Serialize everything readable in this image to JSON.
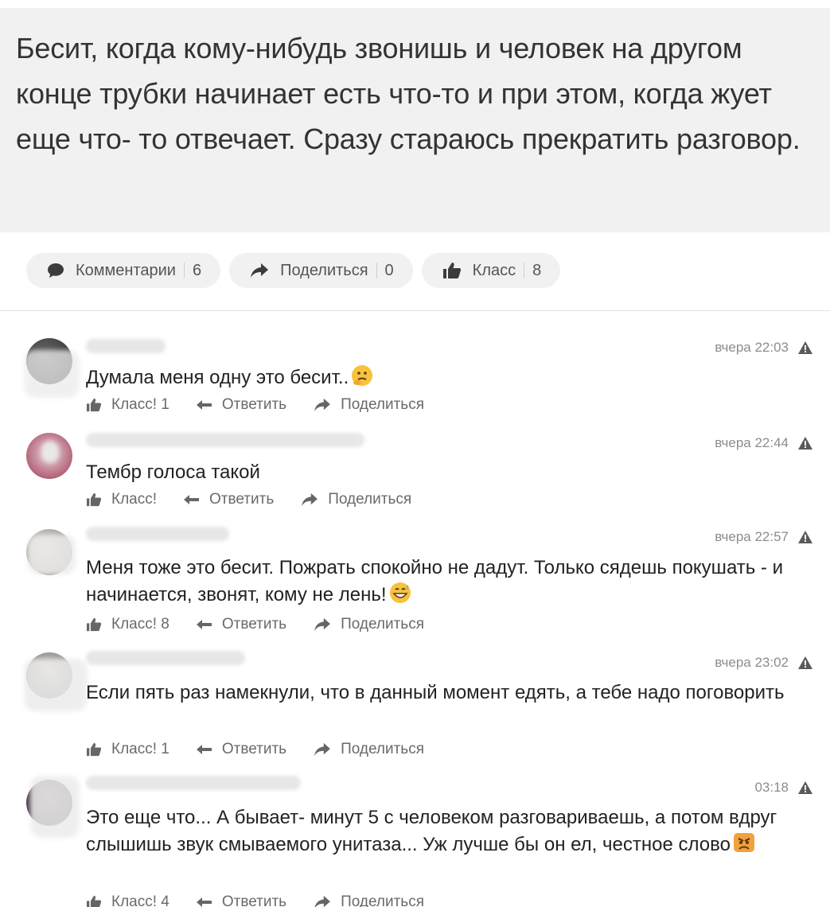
{
  "post": {
    "text": "Бесит, когда кому-нибудь звонишь и человек на другом конце трубки начинает есть что-то и при этом, когда жует еще что- то отвечает. Сразу стараюсь прекратить разговор."
  },
  "actions": {
    "comments_label": "Комментарии",
    "comments_count": "6",
    "share_label": "Поделиться",
    "share_count": "0",
    "like_label": "Класс",
    "like_count": "8"
  },
  "comment_actions": {
    "reply": "Ответить",
    "share": "Поделиться"
  },
  "comments": [
    {
      "time": "вчера 22:03",
      "text": "Думала меня одну это бесит..",
      "like": "Класс! 1",
      "emoji": "thinking-face"
    },
    {
      "time": "вчера 22:44",
      "text": "Тембр голоса такой",
      "like": "Класс!"
    },
    {
      "time": "вчера 22:57",
      "text": "Меня тоже это бесит. Пожрать спокойно не дадут. Только сядешь покушать - и начинается, звонят, кому не лень!",
      "like": "Класс! 8",
      "emoji": "grinning-sweat-face"
    },
    {
      "time": "вчера 23:02",
      "text": "Если пять раз намекнули, что в данный момент едять, а тебе надо поговорить",
      "like": "Класс! 1"
    },
    {
      "time": "03:18",
      "text": "Это еще что... А бывает- минут 5 с человеком разговариваешь, а потом вдруг слышишь звук смываемого унитаза... Уж лучше бы он ел, честное слово",
      "like": "Класс! 4",
      "emoji": "angry-face"
    }
  ],
  "colors": {
    "background": "#ffffff",
    "post_bg": "#f1f1f1",
    "muted": "#8c8c8c"
  }
}
